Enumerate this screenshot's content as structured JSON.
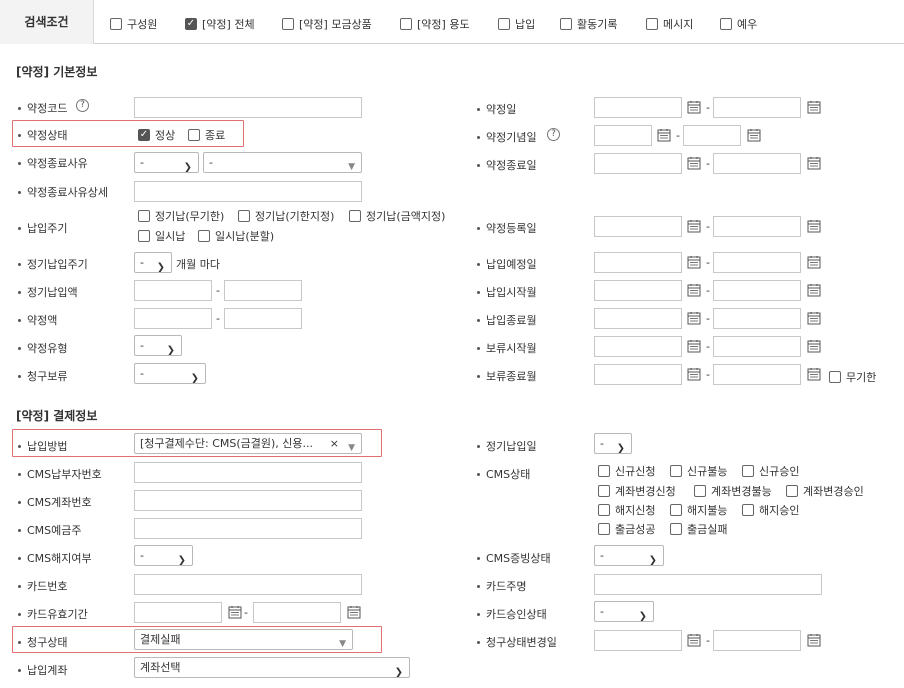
{
  "topbar": {
    "title": "검색조건",
    "options": [
      {
        "label": "구성원",
        "checked": false
      },
      {
        "label": "[약정] 전체",
        "checked": true
      },
      {
        "label": "[약정] 모금상품",
        "checked": false
      },
      {
        "label": "[약정] 용도",
        "checked": false
      },
      {
        "label": "납입",
        "checked": false
      },
      {
        "label": "활동기록",
        "checked": false
      },
      {
        "label": "메시지",
        "checked": false
      },
      {
        "label": "예우",
        "checked": false
      }
    ]
  },
  "basic": {
    "title": "[약정] 기본정보",
    "left": {
      "code": "약정코드",
      "status": "약정상태",
      "status_normal": "정상",
      "status_end": "종료",
      "end_reason": "약정종료사유",
      "end_reason_sel": "-",
      "end_reason_sub_sel": "-",
      "end_reason_detail": "약정종료사유상세",
      "pay_cycle": "납입주기",
      "cycle_opt1": "정기납(무기한)",
      "cycle_opt2": "정기납(기한지정)",
      "cycle_opt3": "정기납(금액지정)",
      "cycle_opt4": "일시납",
      "cycle_opt5": "일시납(분할)",
      "regular_cycle": "정기납입주기",
      "regular_cycle_sel": "-",
      "per_month": "개월 마다",
      "regular_amount": "정기납입액",
      "pledge_amount": "약정액",
      "pledge_type": "약정유형",
      "pledge_type_sel": "-",
      "billing_hold": "청구보류",
      "billing_hold_sel": "-",
      "dash": "-"
    },
    "right": {
      "date": "약정일",
      "anniversary": "약정기념일",
      "end_date": "약정종료일",
      "reg_date": "약정등록일",
      "pay_due": "납입예정일",
      "pay_start": "납입시작월",
      "pay_end": "납입종료월",
      "hold_start": "보류시작월",
      "hold_end": "보류종료월",
      "indefinite": "무기한",
      "dash": "-"
    }
  },
  "payment": {
    "title": "[약정] 결제정보",
    "left": {
      "method": "납입방법",
      "method_sel": "[청구결제수단: CMS(금결원), 신용...",
      "method_clear": "×",
      "cms_payer": "CMS납부자번호",
      "cms_account": "CMS계좌번호",
      "cms_holder": "CMS예금주",
      "cms_cancel": "CMS해지여부",
      "cms_cancel_sel": "-",
      "card_no": "카드번호",
      "card_exp": "카드유효기간",
      "bill_status": "청구상태",
      "bill_status_sel": "결제실패",
      "pay_account": "납입계좌",
      "pay_account_sel": "계좌선택",
      "dash": "-"
    },
    "right": {
      "regular_day": "정기납입일",
      "regular_day_sel": "-",
      "cms_status": "CMS상태",
      "cms_opts": [
        "신규신청",
        "신규불능",
        "신규승인",
        "계좌변경신청",
        "계좌변경불능",
        "계좌변경승인",
        "해지신청",
        "해지불능",
        "해지승인",
        "출금성공",
        "출금실패"
      ],
      "cms_evidence": "CMS증빙상태",
      "cms_evidence_sel": "-",
      "card_holder": "카드주명",
      "card_approval": "카드승인상태",
      "card_approval_sel": "-",
      "bill_status_changed": "청구상태변경일",
      "dash": "-"
    }
  },
  "colors": {
    "highlight": "#e07070",
    "topbar_bg": "#f3f3f3"
  },
  "help_glyph": "?"
}
